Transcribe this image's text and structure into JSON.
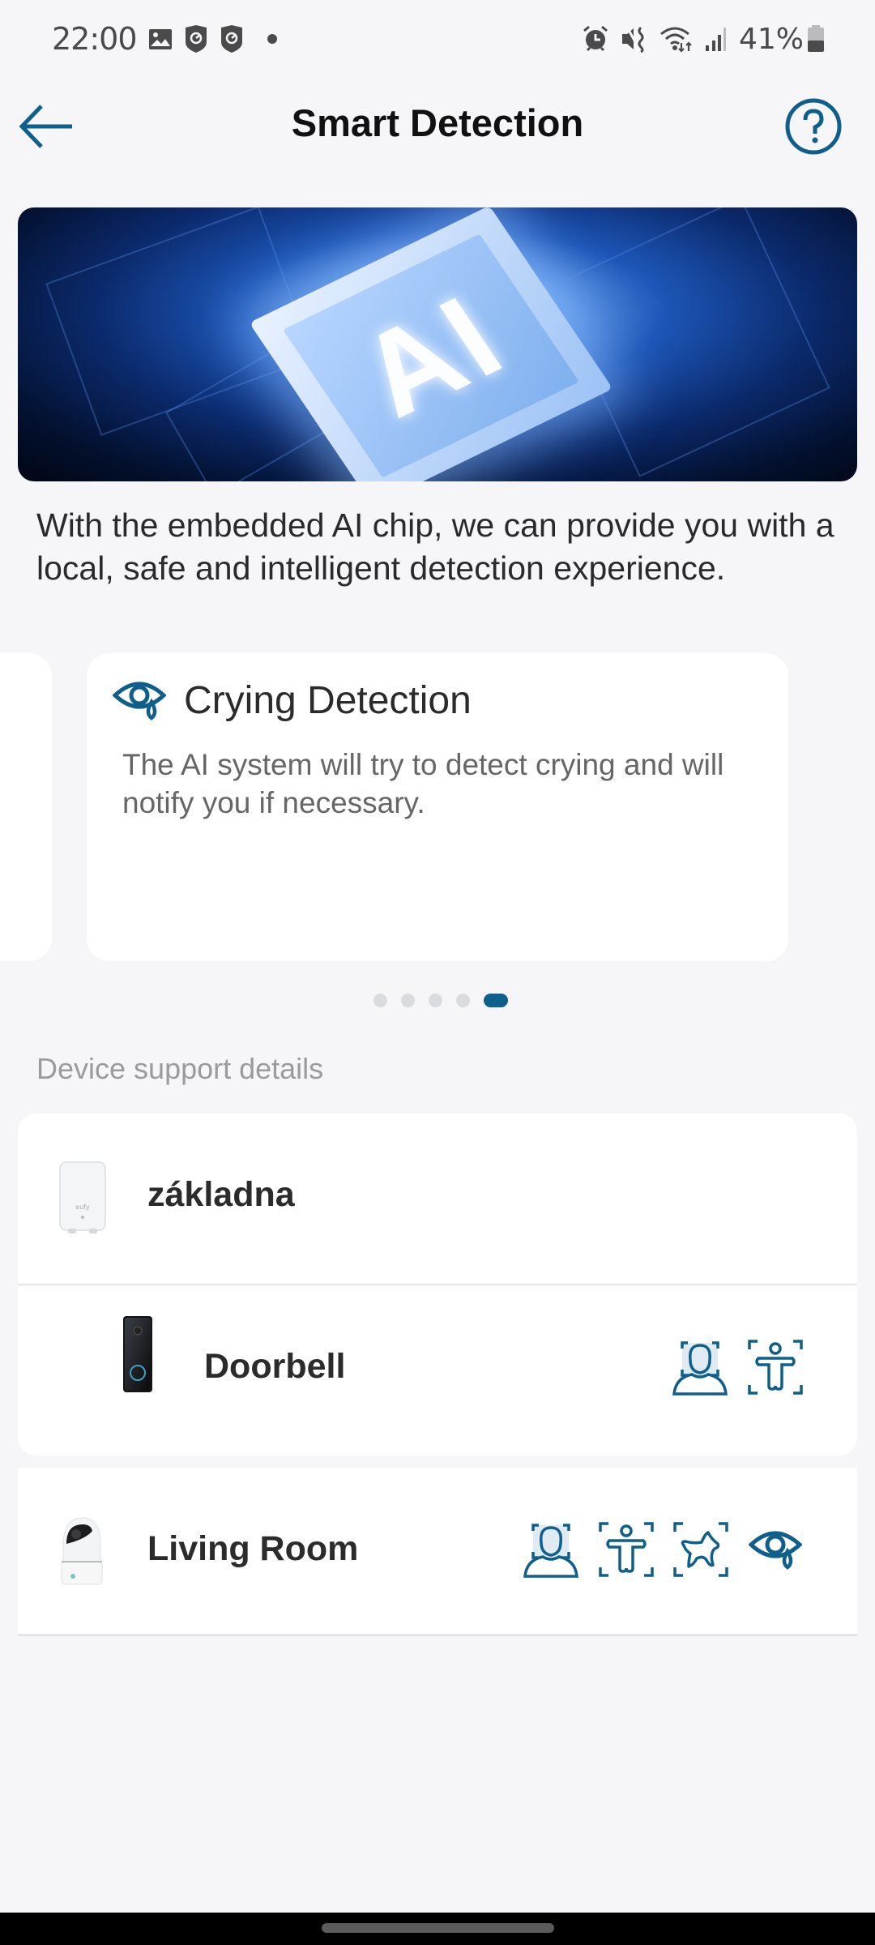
{
  "status_bar": {
    "time": "22:00",
    "left_icons": [
      "image-notification-icon",
      "shield-app-icon",
      "shield-app-icon",
      "more-notifications-dot"
    ],
    "right_icons": [
      "alarm-icon",
      "vibrate-mute-icon",
      "wifi-icon",
      "signal-icon",
      "battery-icon"
    ],
    "battery_percent": "41%",
    "battery_level": 0.41
  },
  "header": {
    "title": "Smart Detection",
    "back_icon": "arrow-left-icon",
    "help_icon": "help-circle-icon"
  },
  "hero": {
    "chip_label": "AI"
  },
  "intro_text": "With the embedded AI chip, we can provide you with a local, safe and intelligent detection experience.",
  "carousel": {
    "current_card": {
      "icon": "crying-eye-icon",
      "title": "Crying Detection",
      "description": "The AI system will try to detect crying and will notify you if necessary."
    },
    "page_count": 5,
    "active_index": 4
  },
  "section_label": "Device support details",
  "devices": [
    {
      "name": "základna",
      "thumb": "homebase-thumb",
      "features": []
    },
    {
      "name": "Doorbell",
      "thumb": "doorbell-thumb",
      "features": [
        "face-detection-icon",
        "human-detection-icon"
      ]
    },
    {
      "name": "Living Room",
      "thumb": "indoor-cam-thumb",
      "features": [
        "face-detection-icon",
        "human-detection-icon",
        "pet-detection-icon",
        "crying-detection-icon"
      ]
    }
  ],
  "colors": {
    "accent": "#0f5f8c",
    "background": "#f6f6f8",
    "card": "#ffffff",
    "dot_inactive": "#d9dbdf"
  }
}
